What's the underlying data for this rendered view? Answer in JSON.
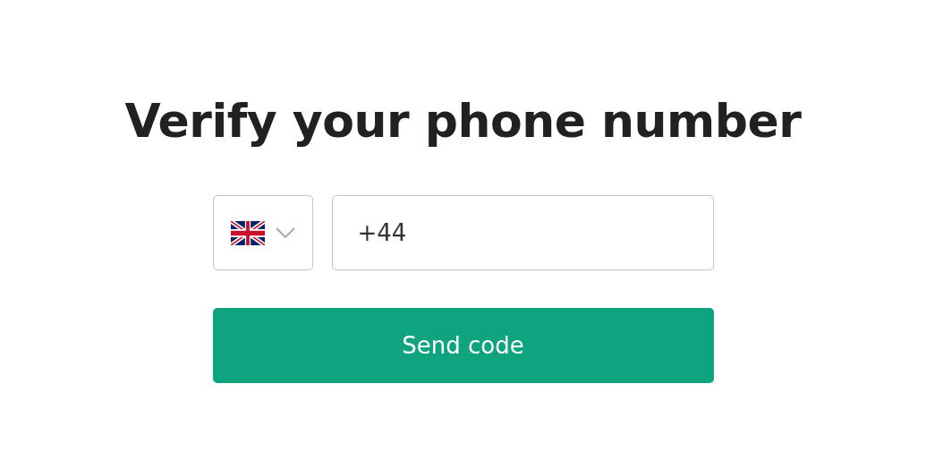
{
  "title": "Verify your phone number",
  "phone_field": {
    "value": "+44"
  },
  "button": "Send code"
}
